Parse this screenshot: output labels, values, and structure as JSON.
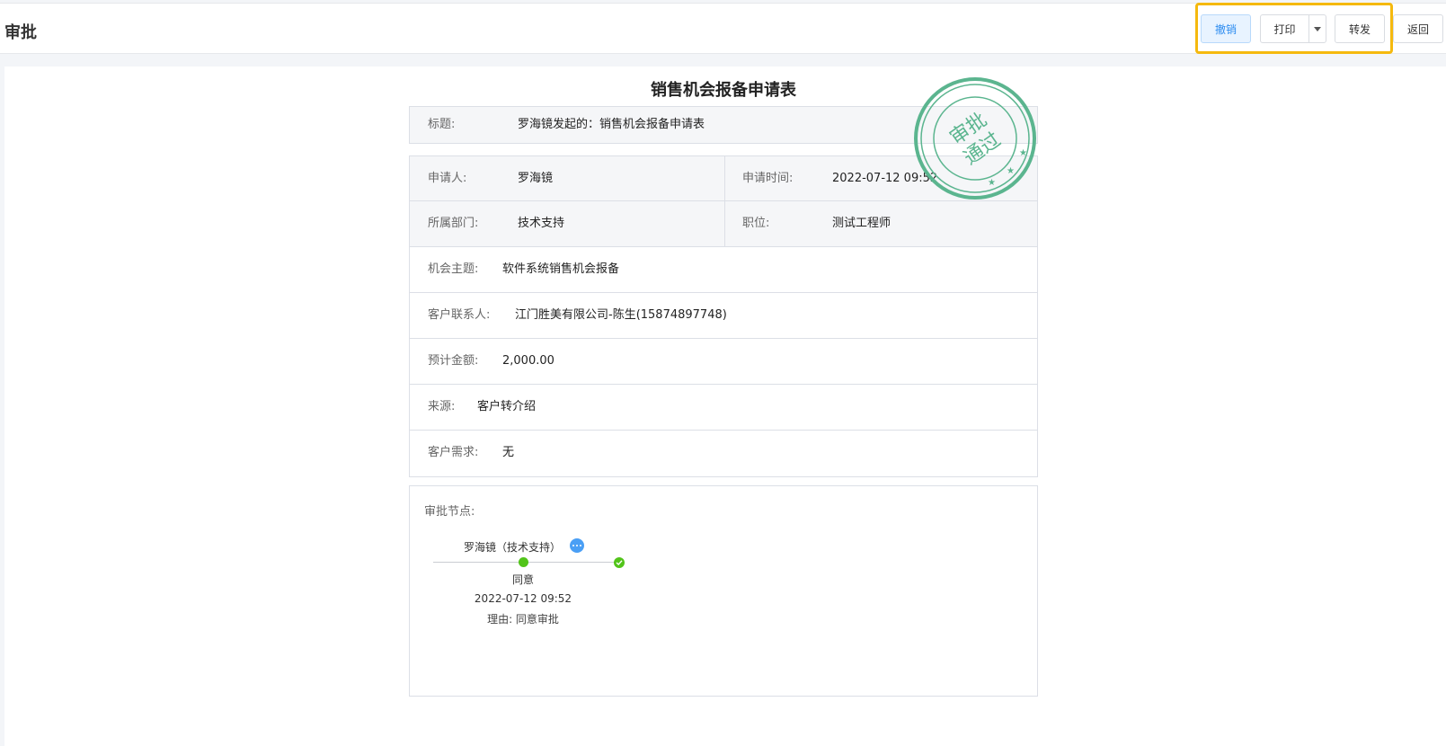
{
  "header": {
    "title": "审批",
    "buttons": {
      "revoke": "撤销",
      "print": "打印",
      "forward": "转发",
      "back": "返回"
    }
  },
  "form": {
    "title": "销售机会报备申请表",
    "subject": {
      "label": "标题:",
      "value": "罗海镜发起的：销售机会报备申请表"
    },
    "applicant": {
      "label": "申请人:",
      "value": "罗海镜"
    },
    "apply_time": {
      "label": "申请时间:",
      "value": "2022-07-12 09:52"
    },
    "department": {
      "label": "所属部门:",
      "value": "技术支持"
    },
    "position": {
      "label": "职位:",
      "value": "测试工程师"
    },
    "opportunity_topic": {
      "label": "机会主题:",
      "value": "软件系统销售机会报备"
    },
    "customer_contact": {
      "label": "客户联系人:",
      "value": "江门胜美有限公司-陈生(15874897748)"
    },
    "estimated_amount": {
      "label": "预计金额:",
      "value": "2,000.00"
    },
    "source": {
      "label": "来源:",
      "value": "客户转介绍"
    },
    "customer_needs": {
      "label": "客户需求:",
      "value": "无"
    }
  },
  "stamp": {
    "text_line1": "审批",
    "text_line2": "通过",
    "color": "#5bb58f"
  },
  "approval": {
    "label": "审批节点:",
    "node": {
      "name": "罗海镜（技术支持）",
      "status": "同意",
      "time": "2022-07-12 09:52",
      "reason": "理由: 同意审批"
    }
  },
  "colors": {
    "accent": "#2d8cf0",
    "highlight": "#f5b90e",
    "success": "#52c41a"
  }
}
